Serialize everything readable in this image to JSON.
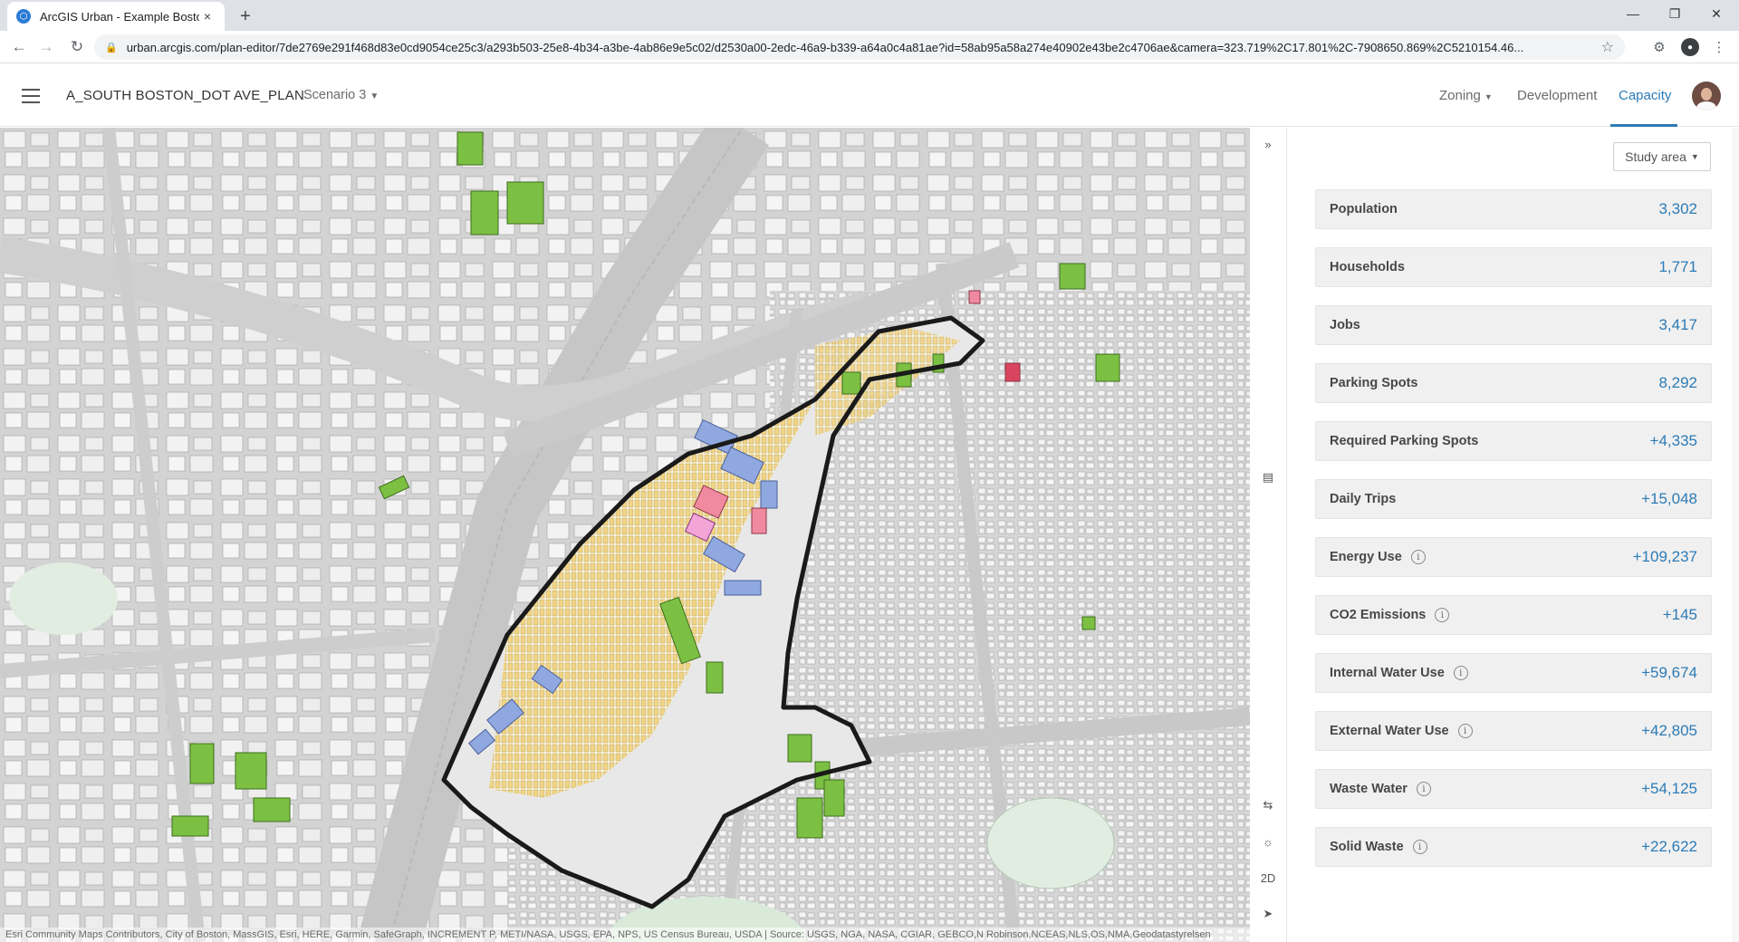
{
  "browser": {
    "tab_title": "ArcGIS Urban - Example Boston,",
    "tab_close": "×",
    "new_tab": "+",
    "url": "urban.arcgis.com/plan-editor/7de2769e291f468d83e0cd9054ce25c3/a293b503-25e8-4b34-a3be-4ab86e9e5c02/d2530a00-2edc-46a9-b339-a64a0c4a81ae?id=58ab95a58a274e40902e43be2c4706ae&camera=323.719%2C17.801%2C-7908650.869%2C5210154.46...",
    "icons": [
      "back-icon",
      "forward-icon",
      "reload-icon",
      "lock-icon",
      "star-icon",
      "extensions-icon",
      "profile-icon",
      "menu-icon",
      "minimize-icon",
      "restore-icon",
      "close-icon"
    ]
  },
  "header": {
    "plan_title": "A_SOUTH BOSTON_DOT AVE_PLAN",
    "scenario": "Scenario 3",
    "nav": {
      "zoning": "Zoning",
      "development": "Development",
      "capacity": "Capacity"
    },
    "active_tab": "Capacity",
    "accent_color": "#2c7bb6"
  },
  "map": {
    "attribution": "Esri Community Maps Contributors, City of Boston, MassGIS, Esri, HERE, Garmin, SafeGraph, INCREMENT P, METI/NASA, USGS, EPA, NPS, US Census Bureau, USDA | Source: USGS, NGA, NASA, CGIAR, GEBCO,N Robinson,NCEAS,NLS,OS,NMA,Geodatastyrelsen",
    "rail": {
      "collapse": "»",
      "mode_2d": "2D"
    },
    "colors": {
      "residential": "#f2d27a",
      "office": "#8fa8e0",
      "commercial": "#f08aa0",
      "green": "#7cc043",
      "boundary": "#1a1a1a"
    }
  },
  "panel": {
    "study_area_button": "Study area",
    "metrics": [
      {
        "label": "Population",
        "value": "3,302",
        "info": false
      },
      {
        "label": "Households",
        "value": "1,771",
        "info": false
      },
      {
        "label": "Jobs",
        "value": "3,417",
        "info": false
      },
      {
        "label": "Parking Spots",
        "value": "8,292",
        "info": false
      },
      {
        "label": "Required Parking Spots",
        "value": "+4,335",
        "info": false
      },
      {
        "label": "Daily Trips",
        "value": "+15,048",
        "info": false
      },
      {
        "label": "Energy Use",
        "value": "+109,237",
        "info": true
      },
      {
        "label": "CO2 Emissions",
        "value": "+145",
        "info": true
      },
      {
        "label": "Internal Water Use",
        "value": "+59,674",
        "info": true
      },
      {
        "label": "External Water Use",
        "value": "+42,805",
        "info": true
      },
      {
        "label": "Waste Water",
        "value": "+54,125",
        "info": true
      },
      {
        "label": "Solid Waste",
        "value": "+22,622",
        "info": true
      }
    ]
  }
}
